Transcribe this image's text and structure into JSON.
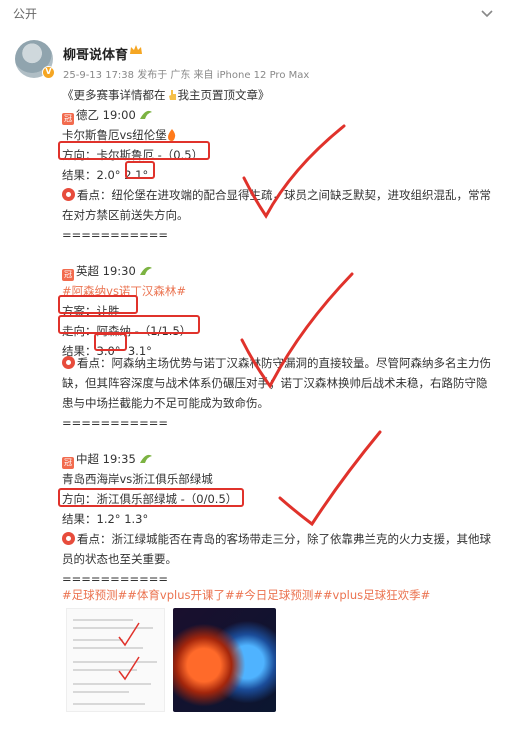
{
  "header": {
    "visibility": "公开"
  },
  "author": {
    "name": "柳哥说体育",
    "meta": "25-9-13 17:38  发布于 广东  来自 iPhone 12 Pro Max"
  },
  "post": {
    "intro_a": "《更多赛事详情都在",
    "intro_b": "我主页置顶文章》",
    "match1": {
      "league_time": "德乙  19:00",
      "teams": "卡尔斯鲁厄vs纽伦堡",
      "direction": "方向：卡尔斯鲁厄 -（0.5）",
      "result_label": "结果：2.0°",
      "result_hit": "2.1°",
      "view": "看点：纽伦堡在进攻端的配合显得生疏，球员之间缺乏默契，进攻组织混乱，常常在对方禁区前送失方向。",
      "separator": "==========="
    },
    "match2": {
      "league_time": "英超  19:30",
      "teams": "#阿森纳vs诺丁汉森林#",
      "plan": "方案：让胜",
      "direction": "走向：阿森纳 -（1/1.5）",
      "result_label": "结果：",
      "result_hit": "3.0°",
      "result_rest": "3.1°",
      "view": "看点：阿森纳主场优势与诺丁汉森林防守漏洞的直接较量。尽管阿森纳多名主力伤缺，但其阵容深度与战术体系仍碾压对手；诺丁汉森林换帅后战术未稳，右路防守隐患与中场拦截能力不足可能成为致命伤。",
      "separator": "==========="
    },
    "match3": {
      "league_time": "中超  19:35",
      "teams": "青岛西海岸vs浙江俱乐部绿城",
      "direction": "方向：浙江俱乐部绿城 -（0/0.5）",
      "result": "结果：1.2°  1.3°",
      "view": "看点：浙江绿城能否在青岛的客场带走三分，除了依靠弗兰克的火力支援，其他球员的状态也至关重要。",
      "separator": "==========="
    },
    "hashtags": "#足球预测##体育vplus开课了##今日足球预测##vplus足球狂欢季#"
  },
  "icons": [
    "more-chevron-icon",
    "crown-icon",
    "verified-badge-icon",
    "league-icon",
    "leaf-icon",
    "fire-icon",
    "pointing-hand-icon",
    "eye-icon",
    "red-check-icon"
  ],
  "colors": {
    "accent": "#eb7350",
    "highlight_box": "#e0322b",
    "meta": "#888888"
  }
}
